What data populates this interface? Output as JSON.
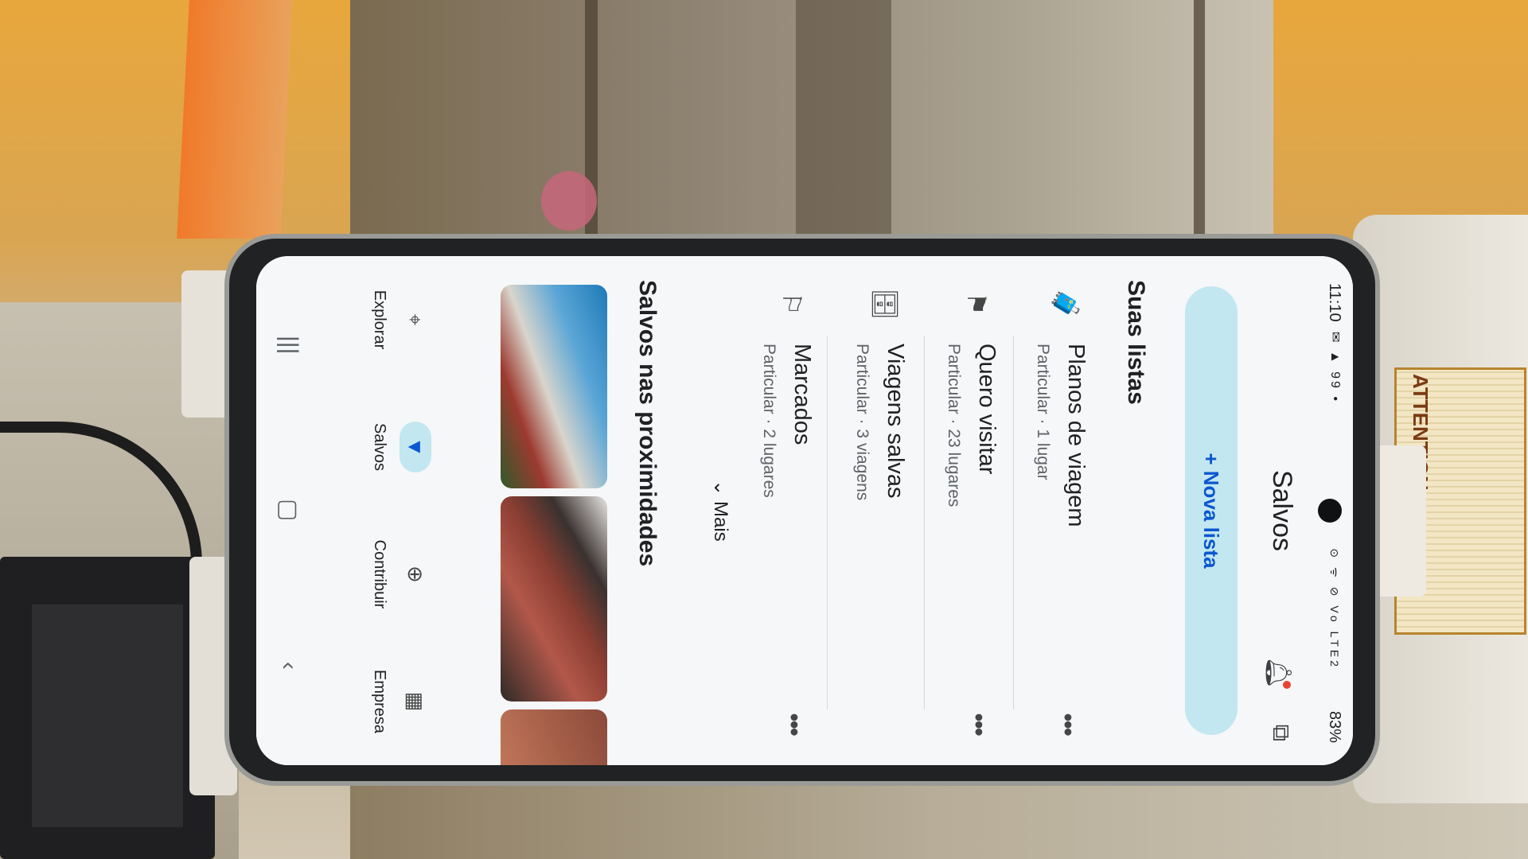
{
  "background": {
    "sticker_text": "ATTENTION"
  },
  "status_bar": {
    "time": "11:10",
    "left_icons": "✉ ▲ 99 •",
    "right_icons": "⊙ ᯤ ⊘ Vo LTE2",
    "battery": "83%"
  },
  "app_bar": {
    "title": "Salvos",
    "bell_icon": "bell-icon",
    "share_icon": "share-icon"
  },
  "new_list_button": {
    "label": "+ Nova lista"
  },
  "your_lists": {
    "title": "Suas listas",
    "items": [
      {
        "icon": "suitcase-icon",
        "glyph": "🧳",
        "name": "Planos de viagem",
        "meta": "Particular · 1 lugar",
        "more": "•••"
      },
      {
        "icon": "flag-icon",
        "glyph": "⚑",
        "name": "Quero visitar",
        "meta": "Particular · 23 lugares",
        "more": "•••"
      },
      {
        "icon": "luggage-icon",
        "glyph": "🗄",
        "name": "Viagens salvas",
        "meta": "Particular · 3 viagens",
        "more": ""
      },
      {
        "icon": "bookmark-flag-icon",
        "glyph": "⚐",
        "name": "Marcados",
        "meta": "Particular · 2 lugares",
        "more": "•••"
      }
    ],
    "more_label": "⌄ Mais"
  },
  "nearby": {
    "title": "Salvos nas proximidades"
  },
  "bottom_nav": {
    "items": [
      {
        "icon": "pin-icon",
        "glyph": "⌖",
        "label": "Explorar",
        "active": false
      },
      {
        "icon": "bookmark-icon",
        "glyph": "▼",
        "label": "Salvos",
        "active": true
      },
      {
        "icon": "add-circle-icon",
        "glyph": "⊕",
        "label": "Contribuir",
        "active": false
      },
      {
        "icon": "store-icon",
        "glyph": "▦",
        "label": "Empresa",
        "active": false
      }
    ]
  },
  "system_nav": {
    "recents": "|||",
    "home": "▢",
    "back": "‹"
  },
  "colors": {
    "accent": "#0b57d0",
    "chip": "#c2e7f0",
    "surface": "#f6f7f8"
  }
}
